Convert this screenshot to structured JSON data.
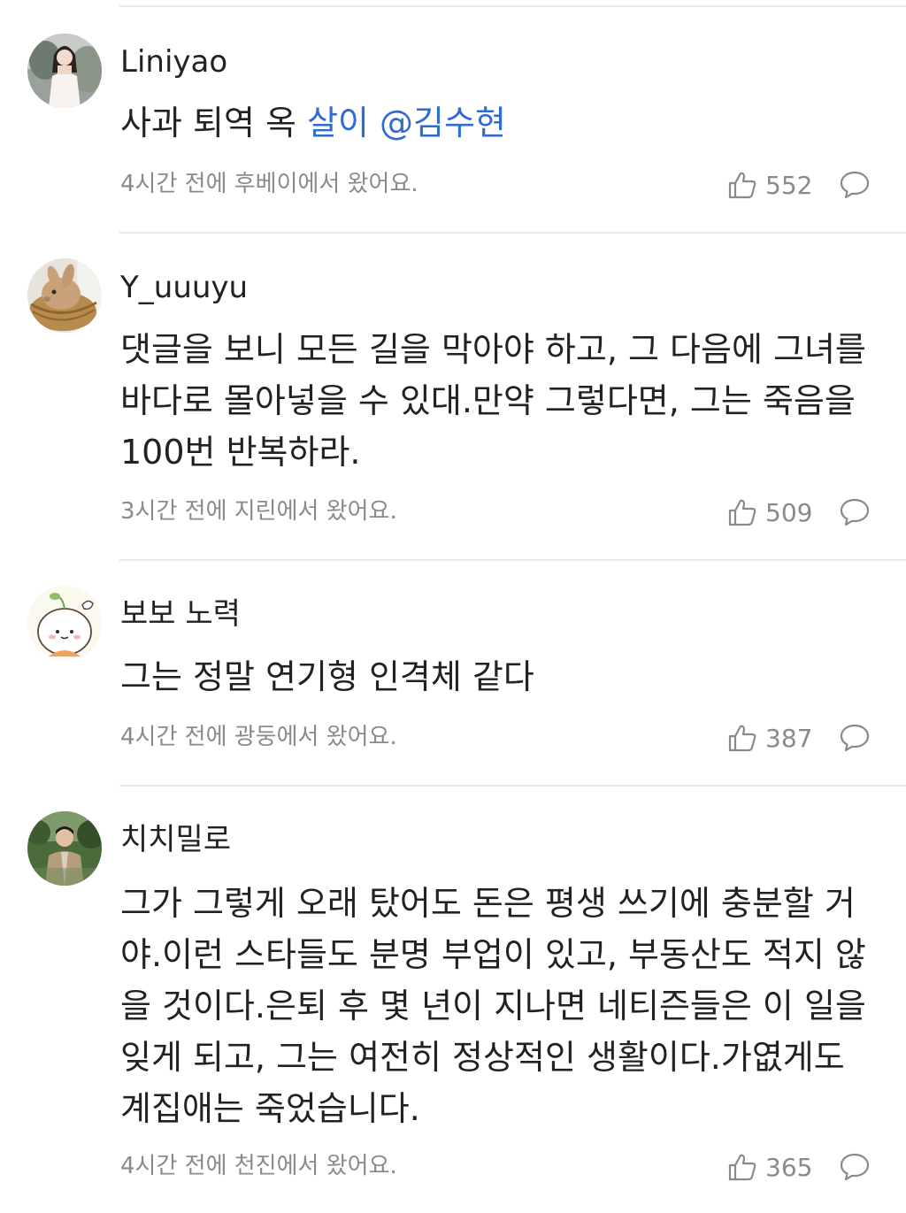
{
  "colors": {
    "text": "#222222",
    "meta": "#8a8a8a",
    "mention": "#2f6bd0",
    "divider": "#e8e8e8"
  },
  "comments": [
    {
      "username": "Liniyao",
      "text_plain": "사과 퇴역 옥",
      "text_mention": "살이 @김수현",
      "meta": "4시간 전에 후베이에서 왔어요.",
      "likes": "552",
      "avatar": "portrait-woman-white-dress"
    },
    {
      "username": "Y_uuuyu",
      "text_plain": "댓글을 보니 모든 길을 막아야 하고, 그 다음에 그녀를 바다로 몰아넣을 수 있대.만약 그렇다면, 그는 죽음을 100번 반복하라.",
      "text_mention": "",
      "meta": "3시간 전에 지린에서 왔어요.",
      "likes": "509",
      "avatar": "rabbit-in-basket"
    },
    {
      "username": "보보 노력",
      "text_plain": "그는 정말 연기형 인격체 같다",
      "text_mention": "",
      "meta": "4시간 전에 광둥에서 왔어요.",
      "likes": "387",
      "avatar": "cartoon-dumpling-sprout"
    },
    {
      "username": "치치밀로",
      "text_plain": "그가 그렇게 오래 탔어도 돈은 평생 쓰기에 충분할 거야.이런 스타들도 분명 부업이 있고, 부동산도 적지 않을 것이다.은퇴 후 몇 년이 지나면 네티즌들은 이 일을 잊게 되고, 그는 여전히 정상적인 생활이다.가엾게도 계집애는 죽었습니다.",
      "text_mention": "",
      "meta": "4시간 전에 천진에서 왔어요.",
      "likes": "365",
      "avatar": "portrait-man-outdoors"
    }
  ],
  "icons": {
    "like": "thumbs-up-icon",
    "reply": "speech-bubble-icon"
  }
}
